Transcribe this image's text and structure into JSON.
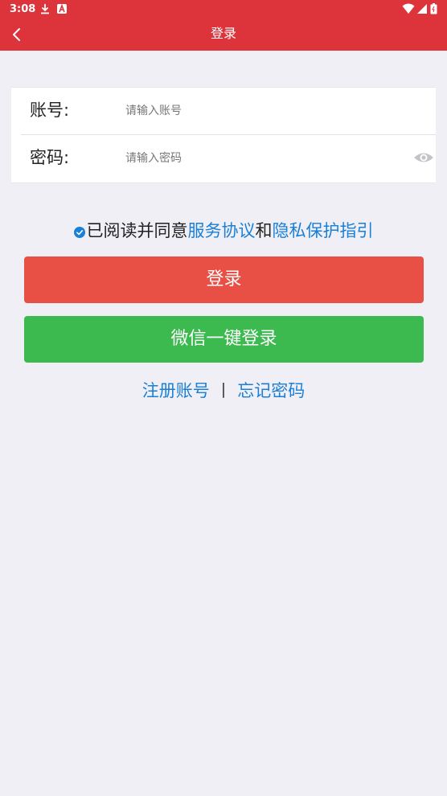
{
  "status_bar": {
    "time": "3:08",
    "icons": [
      "download-icon",
      "notification-a-icon",
      "wifi-icon",
      "signal-icon",
      "battery-icon"
    ]
  },
  "app_bar": {
    "title": "登录",
    "back_icon": "chevron-left-icon"
  },
  "form": {
    "account_label": "账号:",
    "account_placeholder": "请输入账号",
    "account_value": "",
    "password_label": "密码:",
    "password_placeholder": "请输入密码",
    "password_value": "",
    "password_toggle_icon": "eye-icon"
  },
  "agreement": {
    "checked": true,
    "prefix": "已阅读并同意",
    "service_link": "服务协议",
    "conjunction": "和",
    "privacy_link": "隐私保护指引"
  },
  "buttons": {
    "login_label": "登录",
    "wechat_label": "微信一键登录"
  },
  "links": {
    "register": "注册账号",
    "separator": "|",
    "forgot_password": "忘记密码"
  },
  "colors": {
    "header": "#dd333b",
    "login_button": "#e84f45",
    "wechat_button": "#3cba4f",
    "link": "#1a7fd6",
    "background": "#efeff5"
  }
}
